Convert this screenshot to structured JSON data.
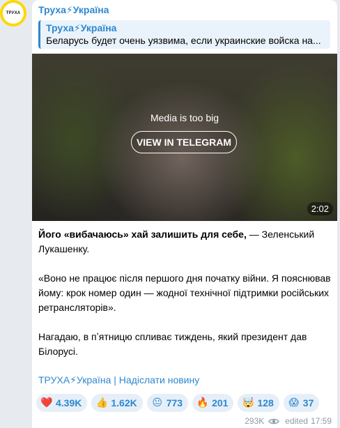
{
  "avatar": {
    "text": "ТРУХА"
  },
  "channel": {
    "name": "Труха⚡Україна"
  },
  "reply": {
    "title": "Труха⚡Україна",
    "text": "Беларусь будет очень уязвима, если украинские войска на..."
  },
  "media": {
    "message": "Media is too big",
    "button_label": "VIEW IN TELEGRAM",
    "duration": "2:02"
  },
  "post": {
    "p1_bold": "Його «вибачаюсь» хай залишить для себе,",
    "p1_rest": " — Зеленський Лукашенку.",
    "p2": "«Воно не працює після першого дня початку війни. Я пояснював йому: крок номер один — жодної технічної підтримки російських ретрансляторів».",
    "p3": "Нагадаю, в пʼятницю спливає тиждень, який президент дав Білорусі.",
    "link_text": "ТРУХА⚡Україна | Надіслати новину"
  },
  "reactions": [
    {
      "emoji": "❤️",
      "icon": "heart-icon",
      "count": "4.39K"
    },
    {
      "emoji": "👍",
      "icon": "thumbs-up-icon",
      "count": "1.62K"
    },
    {
      "emoji": "😐",
      "icon": "face-icon",
      "count": "773"
    },
    {
      "emoji": "🔥",
      "icon": "fire-icon",
      "count": "201"
    },
    {
      "emoji": "🤯",
      "icon": "exploding-head-icon",
      "count": "128"
    },
    {
      "emoji": "😱",
      "icon": "scream-icon",
      "count": "37"
    }
  ],
  "meta": {
    "views": "293K",
    "edited_label": "edited",
    "time": "17:59"
  },
  "colors": {
    "accent": "#2e87cf",
    "avatar_ring": "#ffd700",
    "background": "#e7ebf0"
  }
}
